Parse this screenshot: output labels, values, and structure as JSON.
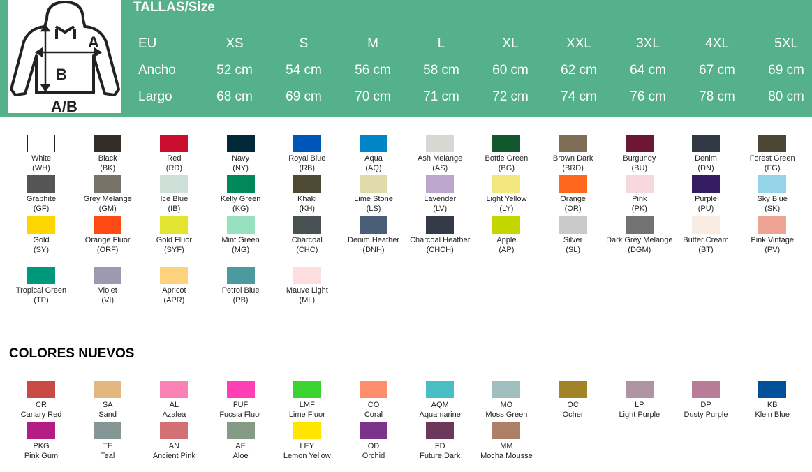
{
  "size_table": {
    "title": "TALLAS/Size",
    "diagram_labels": {
      "a": "A",
      "b": "B",
      "ab": "A/B"
    },
    "header_label": "EU",
    "sizes": [
      "XS",
      "S",
      "M",
      "L",
      "XL",
      "XXL",
      "3XL",
      "4XL",
      "5XL"
    ],
    "rows": [
      {
        "label": "Ancho",
        "values": [
          "52 cm",
          "54 cm",
          "56 cm",
          "58 cm",
          "60 cm",
          "62 cm",
          "64 cm",
          "67 cm",
          "69 cm"
        ]
      },
      {
        "label": "Largo",
        "values": [
          "68 cm",
          "69 cm",
          "70 cm",
          "71 cm",
          "72 cm",
          "74 cm",
          "76 cm",
          "78 cm",
          "80 cm"
        ]
      }
    ]
  },
  "colors": [
    [
      {
        "name": "White",
        "code": "(WH)",
        "hex": "#ffffff"
      },
      {
        "name": "Black",
        "code": "(BK)",
        "hex": "#322d28"
      },
      {
        "name": "Red",
        "code": "(RD)",
        "hex": "#cc0e2e"
      },
      {
        "name": "Navy",
        "code": "(NY)",
        "hex": "#02293a"
      },
      {
        "name": "Royal Blue",
        "code": "(RB)",
        "hex": "#0055bb"
      },
      {
        "name": "Aqua",
        "code": "(AQ)",
        "hex": "#0086c6"
      },
      {
        "name": "Ash Melange",
        "code": "(AS)",
        "hex": "#d8d7d2"
      },
      {
        "name": "Bottle Green",
        "code": "(BG)",
        "hex": "#12572e"
      },
      {
        "name": "Brown Dark",
        "code": "(BRD)",
        "hex": "#806d55"
      },
      {
        "name": "Burgundy",
        "code": "(BU)",
        "hex": "#6a1734"
      },
      {
        "name": "Denim",
        "code": "(DN)",
        "hex": "#313a44"
      },
      {
        "name": "Forest Green",
        "code": "(FG)",
        "hex": "#4b4732"
      }
    ],
    [
      {
        "name": "Graphite",
        "code": "(GF)",
        "hex": "#555555"
      },
      {
        "name": "Grey Melange",
        "code": "(GM)",
        "hex": "#787369"
      },
      {
        "name": "Ice Blue",
        "code": "(IB)",
        "hex": "#cfe0d8"
      },
      {
        "name": "Kelly Green",
        "code": "(KG)",
        "hex": "#00875a"
      },
      {
        "name": "Khaki",
        "code": "(KH)",
        "hex": "#4e4933"
      },
      {
        "name": "Lime Stone",
        "code": "(LS)",
        "hex": "#e0dbab"
      },
      {
        "name": "Lavender",
        "code": "(LV)",
        "hex": "#bca6cf"
      },
      {
        "name": "Light Yellow",
        "code": "(LY)",
        "hex": "#f1e77e"
      },
      {
        "name": "Orange",
        "code": "(OR)",
        "hex": "#ff671f"
      },
      {
        "name": "Pink",
        "code": "(PK)",
        "hex": "#f6d8e0"
      },
      {
        "name": "Purple",
        "code": "(PU)",
        "hex": "#341d62"
      },
      {
        "name": "Sky Blue",
        "code": "(SK)",
        "hex": "#95d3e8"
      }
    ],
    [
      {
        "name": "Gold",
        "code": "(SY)",
        "hex": "#fdd500"
      },
      {
        "name": "Orange Fluor",
        "code": "(ORF)",
        "hex": "#ff4a16"
      },
      {
        "name": "Gold Fluor",
        "code": "(SYF)",
        "hex": "#e1e532"
      },
      {
        "name": "Mint Green",
        "code": "(MG)",
        "hex": "#98e1c0"
      },
      {
        "name": "Charcoal",
        "code": "(CHC)",
        "hex": "#485052"
      },
      {
        "name": "Denim Heather",
        "code": "(DNH)",
        "hex": "#4a5e78"
      },
      {
        "name": "Charcoal Heather",
        "code": "(CHCH)",
        "hex": "#343a48"
      },
      {
        "name": "Apple",
        "code": "(AP)",
        "hex": "#c4d600"
      },
      {
        "name": "Silver",
        "code": "(SL)",
        "hex": "#cacaca"
      },
      {
        "name": "Dark Grey Melange",
        "code": "(DGM)",
        "hex": "#727273"
      },
      {
        "name": "Butter Cream",
        "code": "(BT)",
        "hex": "#f9ede3"
      },
      {
        "name": "Pink Vintage",
        "code": "(PV)",
        "hex": "#eea494"
      }
    ],
    [
      {
        "name": "Tropical Green",
        "code": "(TP)",
        "hex": "#00987a"
      },
      {
        "name": "Violet",
        "code": "(VI)",
        "hex": "#9c99b1"
      },
      {
        "name": "Apricot",
        "code": "(APR)",
        "hex": "#fed17e"
      },
      {
        "name": "Petrol Blue",
        "code": "(PB)",
        "hex": "#4b9aa0"
      },
      {
        "name": "Mauve Light",
        "code": "(ML)",
        "hex": "#fdddde"
      }
    ]
  ],
  "new_colors_title": "COLORES NUEVOS",
  "new_colors": [
    [
      {
        "code": "CR",
        "name": "Canary Red",
        "hex": "#c94a45"
      },
      {
        "code": "SA",
        "name": "Sand",
        "hex": "#e2b87e"
      },
      {
        "code": "AL",
        "name": "Azalea",
        "hex": "#f981b6"
      },
      {
        "code": "FUF",
        "name": "Fucsia Fluor",
        "hex": "#ff3fb4"
      },
      {
        "code": "LMF",
        "name": "Lime Fluor",
        "hex": "#3bd331"
      },
      {
        "code": "CO",
        "name": "Coral",
        "hex": "#ff8c6a"
      },
      {
        "code": "AQM",
        "name": "Aquamarine",
        "hex": "#4abec5"
      },
      {
        "code": "MO",
        "name": "Moss Green",
        "hex": "#a1bfbf"
      },
      {
        "code": "OC",
        "name": "Ocher",
        "hex": "#a28428"
      },
      {
        "code": "LP",
        "name": "Light Purple",
        "hex": "#b094a4"
      },
      {
        "code": "DP",
        "name": "Dusty Purple",
        "hex": "#b87b98"
      },
      {
        "code": "KB",
        "name": "Klein Blue",
        "hex": "#01509c"
      }
    ],
    [
      {
        "code": "PKG",
        "name": "Pink Gum",
        "hex": "#b41d83"
      },
      {
        "code": "TE",
        "name": "Teal",
        "hex": "#859794"
      },
      {
        "code": "AN",
        "name": "Ancient Pink",
        "hex": "#d27074"
      },
      {
        "code": "AE",
        "name": "Aloe",
        "hex": "#869b86"
      },
      {
        "code": "LEY",
        "name": "Lemon Yellow",
        "hex": "#ffe500"
      },
      {
        "code": "OD",
        "name": "Orchid",
        "hex": "#7b338b"
      },
      {
        "code": "FD",
        "name": "Future Dark",
        "hex": "#6c385c"
      },
      {
        "code": "MM",
        "name": "Mocha Mousse",
        "hex": "#ad7f66"
      }
    ]
  ]
}
